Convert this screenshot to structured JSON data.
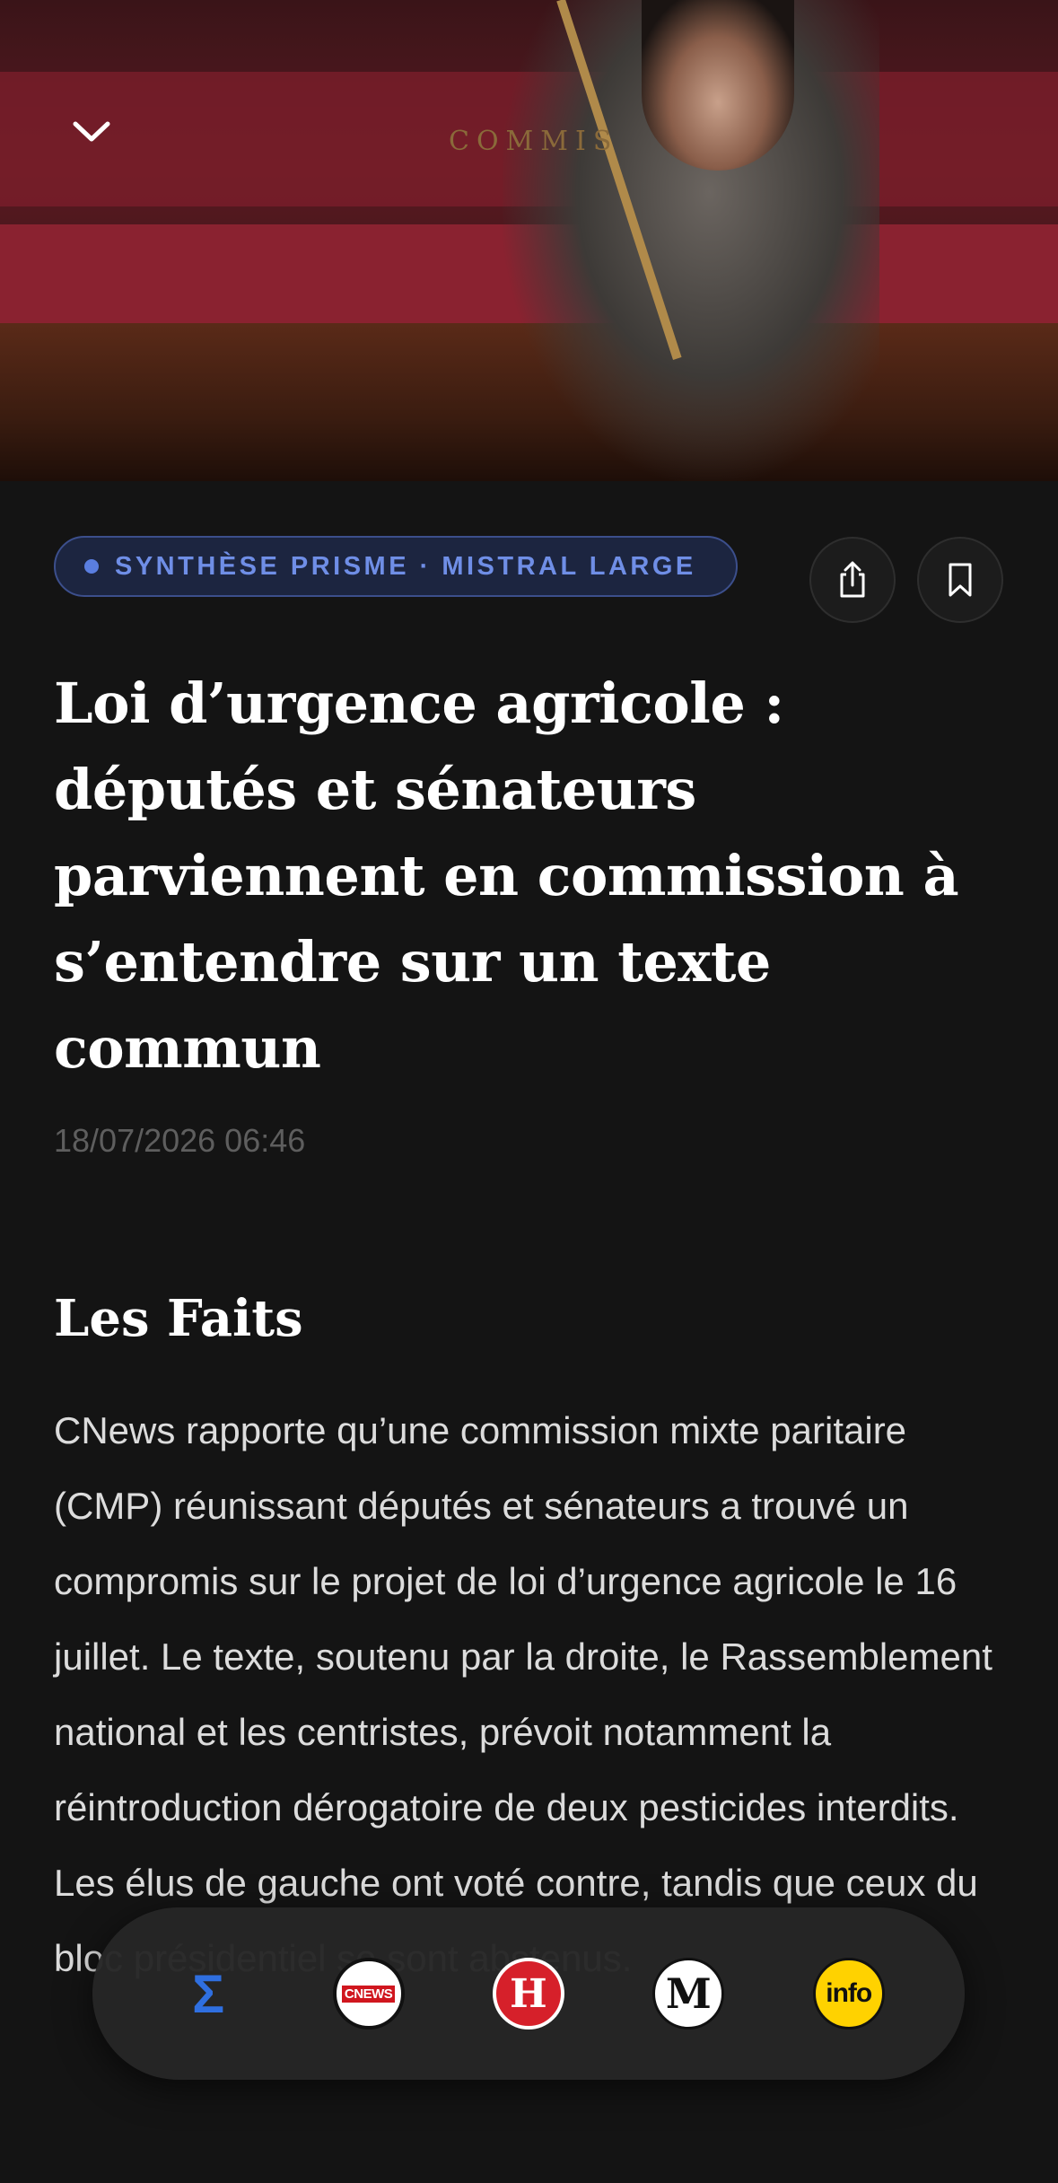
{
  "hero": {
    "image_alt": "Photo d'une députée dans l'hémicycle",
    "commission_text": "COMMIS"
  },
  "tag": {
    "label": "SYNTHÈSE PRISME · MISTRAL LARGE"
  },
  "article": {
    "title": "Loi d’urgence agricole : députés et sénateurs parviennent en commission à s’entendre sur un texte commun",
    "date": "18/07/2026 06:46",
    "section_title": "Les Faits",
    "body": "CNews rapporte qu’une commission mixte paritaire (CMP) réunissant députés et sénateurs a trouvé un compromis sur le projet de loi d’urgence agricole le 16 juillet. Le texte, soutenu par la droite, le Rassemblement national et les centristes, prévoit notamment la réintroduction dérogatoire de deux pesticides interdits. Les élus de gauche ont voté contre, tandis que ceux du bloc présidentiel se sont abstenus."
  },
  "sources": [
    {
      "name": "prisme",
      "label": "Σ"
    },
    {
      "name": "cnews",
      "label": "CNEWS"
    },
    {
      "name": "humanite",
      "label": "H"
    },
    {
      "name": "le-monde",
      "label": "M"
    },
    {
      "name": "franceinfo",
      "label": "info"
    }
  ],
  "icons": [
    "chevron-down-icon",
    "share-icon",
    "bookmark-icon"
  ],
  "colors": {
    "background": "#141414",
    "accent": "#5a7ee0",
    "pill_bg": "#1c2540",
    "pill_border": "#3c4f8c"
  }
}
